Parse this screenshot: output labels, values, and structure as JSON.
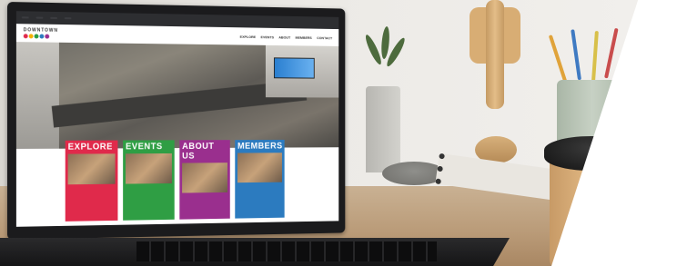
{
  "browser": {
    "tabs": [
      "",
      "",
      "",
      ""
    ]
  },
  "site": {
    "logo_text": "DOWNTOWN",
    "logo_dots": [
      "#e02a4b",
      "#f5b100",
      "#2f9e44",
      "#2c7bbf",
      "#9a2f8e"
    ],
    "nav": [
      "EXPLORE",
      "EVENTS",
      "ABOUT",
      "MEMBERS",
      "CONTACT"
    ],
    "cards": [
      {
        "title": "EXPLORE",
        "color": "#e02a4b",
        "text": ""
      },
      {
        "title": "EVENTS",
        "color": "#2f9e44",
        "text": ""
      },
      {
        "title": "ABOUT US",
        "color": "#9a2f8e",
        "text": ""
      },
      {
        "title": "MEMBERS",
        "color": "#2c7bbf",
        "text": ""
      }
    ]
  },
  "scene": {
    "objects": [
      "laptop",
      "plant",
      "wooden-hand-mannequin",
      "pencil-cup",
      "notebook",
      "coffee-cup"
    ]
  }
}
